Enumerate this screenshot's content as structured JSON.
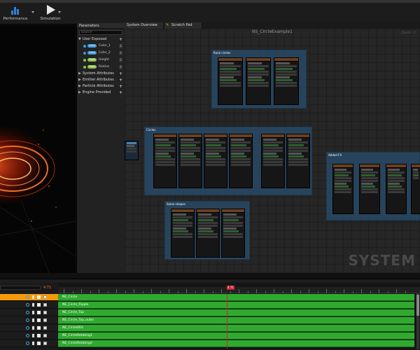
{
  "toolbar": {
    "performance_label": "Performance",
    "simulation_label": "Simulation"
  },
  "params": {
    "tab_label": "Parameters",
    "search_placeholder": "Search",
    "user_exposed": "User Exposed",
    "items": [
      {
        "type": "Color",
        "name": "Color_1",
        "pill_color": "#3a9ad9",
        "value": "2"
      },
      {
        "type": "Color",
        "name": "Color_2",
        "pill_color": "#3a9ad9",
        "value": "2"
      },
      {
        "type": "Float",
        "name": "Height",
        "pill_color": "#8ac14b",
        "value": "2"
      },
      {
        "type": "Float",
        "name": "Radius",
        "pill_color": "#8ac14b",
        "value": "2"
      }
    ],
    "sections": [
      "System Attributes",
      "Emitter Attributes",
      "Particle Attributes",
      "Engine Provided"
    ]
  },
  "graph": {
    "tabs": [
      "System Overview",
      "Scratch Pad"
    ],
    "title": "NS_CircleExample1",
    "zoom": "Zoom -1",
    "watermark": "SYSTEM",
    "comments": [
      "Rune circles",
      "Circles",
      "Added FX",
      "Some shapes"
    ]
  },
  "sequencer": {
    "time_left": "4.71",
    "playhead": "4.71",
    "tracks": [
      {
        "name": "NE_Circle",
        "selected": true
      },
      {
        "name": "NE_Circle_Ripple",
        "selected": false
      },
      {
        "name": "NE_Circle_Top",
        "selected": false
      },
      {
        "name": "NE_Circle_Top_outer",
        "selected": false
      },
      {
        "name": "NE_Circle003",
        "selected": false
      },
      {
        "name": "NE_CircleRotating1",
        "selected": false
      },
      {
        "name": "NE_CircleRotating2",
        "selected": false
      }
    ]
  },
  "colors": {
    "accent_orange": "#f59a0b",
    "track_green": "#2faa2f",
    "playhead_red": "#c1272d",
    "comment_blue": "#28465f"
  }
}
